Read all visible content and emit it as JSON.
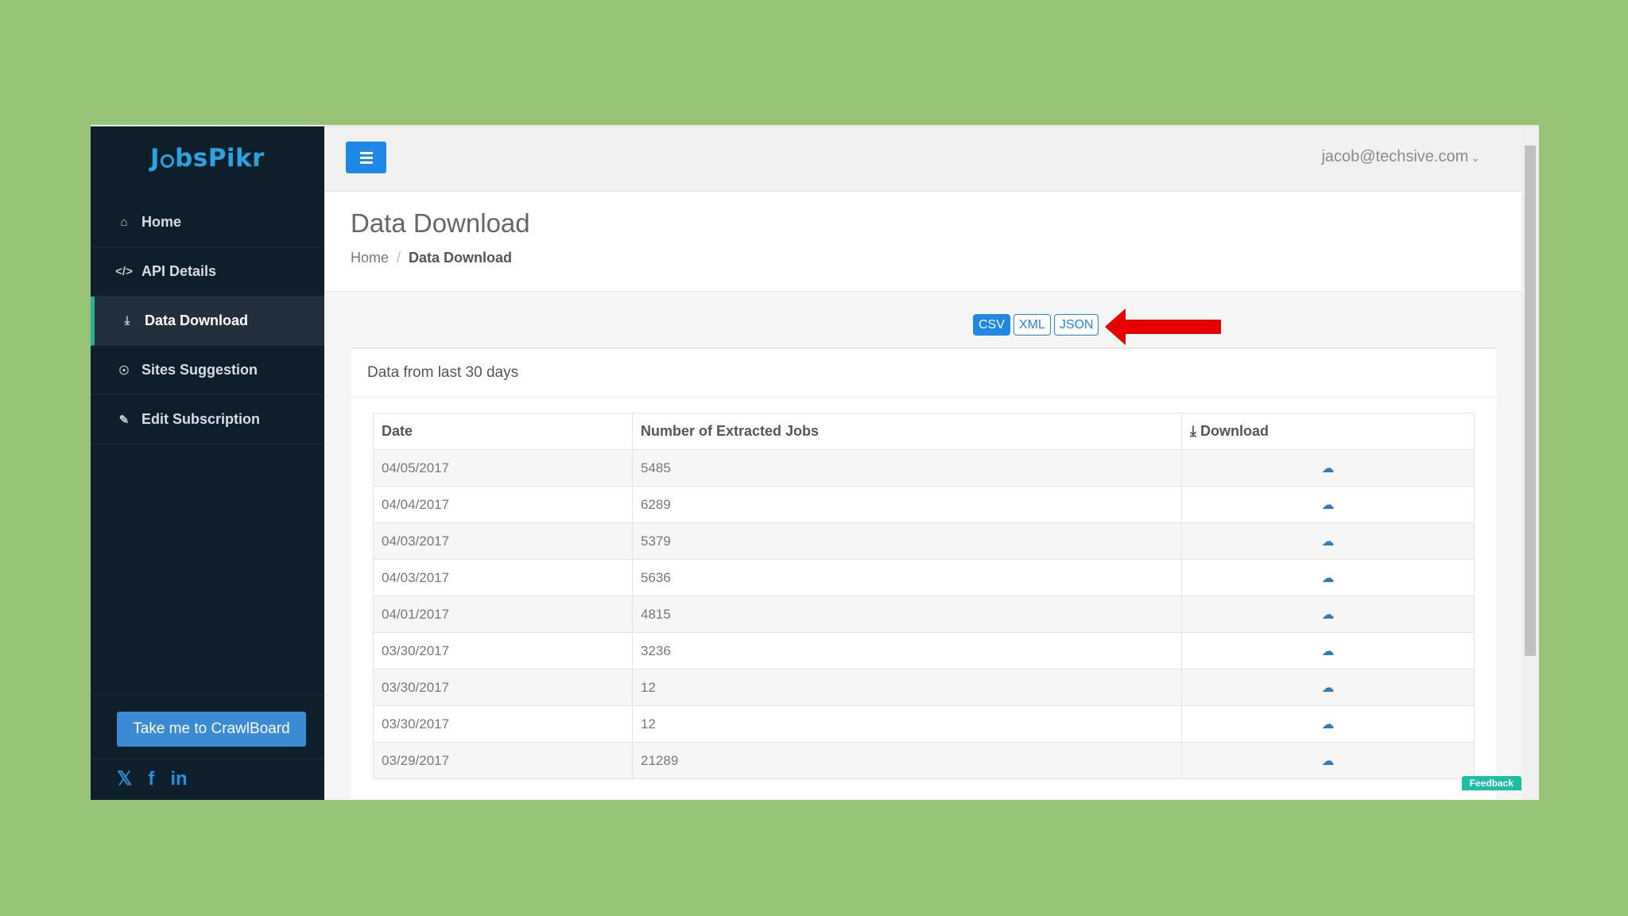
{
  "brand": {
    "logo_pre": "J",
    "logo_post": "bsPikr"
  },
  "sidebar": {
    "items": [
      {
        "label": "Home",
        "icon": "home-icon"
      },
      {
        "label": "API Details",
        "icon": "code-icon"
      },
      {
        "label": "Data Download",
        "icon": "download-icon",
        "active": true
      },
      {
        "label": "Sites Suggestion",
        "icon": "lightbulb-icon"
      },
      {
        "label": "Edit Subscription",
        "icon": "edit-icon"
      }
    ],
    "crawlboard_label": "Take me to CrawlBoard"
  },
  "topbar": {
    "user": "jacob@techsive.com"
  },
  "page": {
    "title": "Data Download",
    "breadcrumb": {
      "home": "Home",
      "sep": "/",
      "current": "Data Download"
    }
  },
  "formats": {
    "csv": "CSV",
    "xml": "XML",
    "json": "JSON",
    "selected": "CSV"
  },
  "panel": {
    "title": "Data from last 30 days",
    "columns": {
      "date": "Date",
      "jobs": "Number of Extracted Jobs",
      "download": "Download"
    },
    "rows": [
      {
        "date": "04/05/2017",
        "jobs": "5485"
      },
      {
        "date": "04/04/2017",
        "jobs": "6289"
      },
      {
        "date": "04/03/2017",
        "jobs": "5379"
      },
      {
        "date": "04/03/2017",
        "jobs": "5636"
      },
      {
        "date": "04/01/2017",
        "jobs": "4815"
      },
      {
        "date": "03/30/2017",
        "jobs": "3236"
      },
      {
        "date": "03/30/2017",
        "jobs": "12"
      },
      {
        "date": "03/30/2017",
        "jobs": "12"
      },
      {
        "date": "03/29/2017",
        "jobs": "21289"
      }
    ]
  },
  "feedback_label": "Feedback",
  "colors": {
    "accent": "#1f87e5",
    "sidebar": "#0e1e2b",
    "active_bar": "#29b08f",
    "arrow": "#e60000"
  }
}
